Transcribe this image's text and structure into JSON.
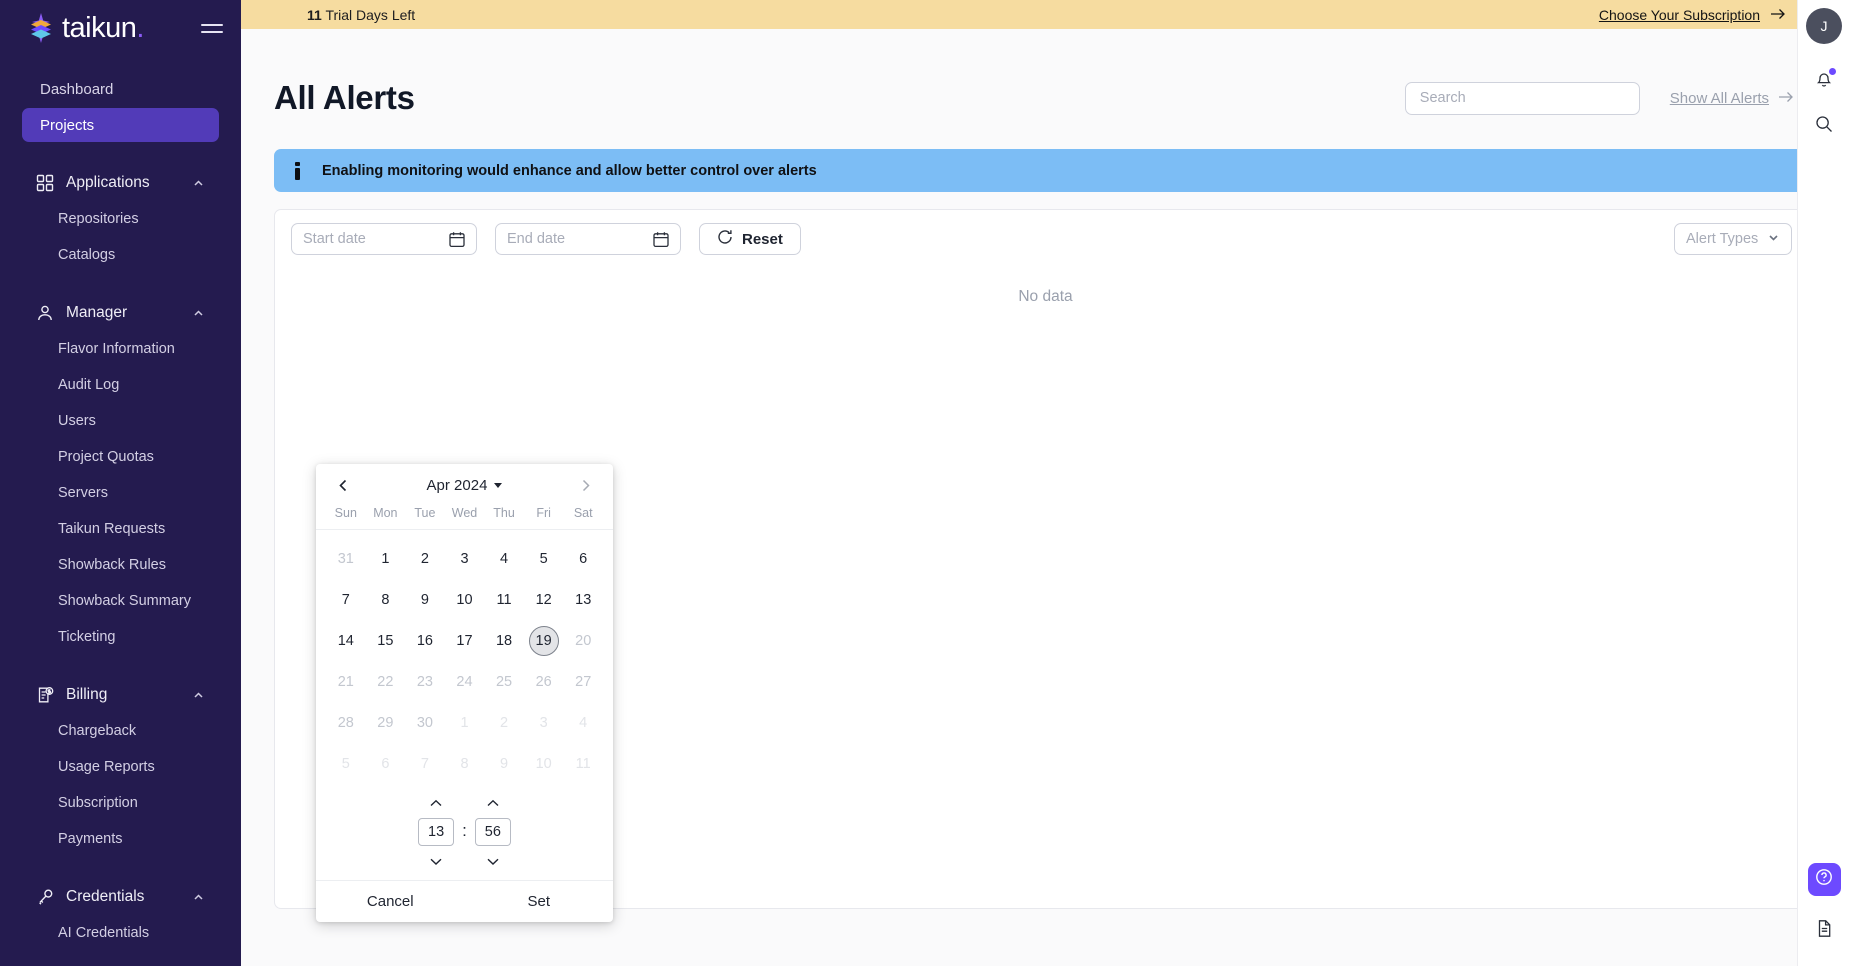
{
  "brand": {
    "name": "taikun",
    "dot": ".",
    "logo_icon": "taikun-logo-icon",
    "menu_icon": "hamburger-menu-icon"
  },
  "sidebar": {
    "top_items": [
      {
        "label": "Dashboard",
        "active": false
      },
      {
        "label": "Projects",
        "active": true
      }
    ],
    "groups": [
      {
        "label": "Applications",
        "icon": "grid-icon",
        "chevron": "chevron-up-icon",
        "items": [
          {
            "label": "Repositories"
          },
          {
            "label": "Catalogs"
          }
        ]
      },
      {
        "label": "Manager",
        "icon": "user-icon",
        "chevron": "chevron-up-icon",
        "items": [
          {
            "label": "Flavor Information"
          },
          {
            "label": "Audit Log"
          },
          {
            "label": "Users"
          },
          {
            "label": "Project Quotas"
          },
          {
            "label": "Servers"
          },
          {
            "label": "Taikun Requests"
          },
          {
            "label": "Showback Rules"
          },
          {
            "label": "Showback Summary"
          },
          {
            "label": "Ticketing"
          }
        ]
      },
      {
        "label": "Billing",
        "icon": "invoice-dollar-icon",
        "chevron": "chevron-up-icon",
        "items": [
          {
            "label": "Chargeback"
          },
          {
            "label": "Usage Reports"
          },
          {
            "label": "Subscription"
          },
          {
            "label": "Payments"
          }
        ]
      },
      {
        "label": "Credentials",
        "icon": "key-icon",
        "chevron": "chevron-up-icon",
        "items": [
          {
            "label": "AI Credentials"
          }
        ]
      }
    ]
  },
  "trial_bar": {
    "days": "11",
    "text": " Trial Days Left",
    "cta_label": "Choose Your Subscription",
    "cta_icon": "arrow-right-icon",
    "bg_color": "#f6dca0"
  },
  "header": {
    "title": "All Alerts",
    "search": {
      "value": "",
      "placeholder": "Search",
      "name": "search-input"
    },
    "show_all_label": "Show All Alerts",
    "show_all_icon": "arrow-right-icon"
  },
  "info_banner": {
    "icon": "info-icon",
    "message": "Enabling monitoring would enhance and allow better control over alerts",
    "bg_color": "#7cbdf5"
  },
  "filters": {
    "start_date": {
      "value": "",
      "placeholder": "Start date",
      "icon": "calendar-icon"
    },
    "end_date": {
      "value": "",
      "placeholder": "End date",
      "icon": "calendar-icon"
    },
    "reset_label": "Reset",
    "reset_icon": "refresh-icon",
    "alert_types": {
      "value": "Alert Types",
      "icon": "chevron-down-icon"
    }
  },
  "table": {
    "empty_message": "No data"
  },
  "calendar": {
    "prev_icon": "chevron-left-icon",
    "next_icon": "chevron-right-icon",
    "month_label": "Apr 2024",
    "caret_icon": "caret-down-icon",
    "day_names": [
      "Sun",
      "Mon",
      "Tue",
      "Wed",
      "Thu",
      "Fri",
      "Sat"
    ],
    "weeks": [
      [
        {
          "d": "31",
          "s": "muted"
        },
        {
          "d": "1",
          "s": ""
        },
        {
          "d": "2",
          "s": ""
        },
        {
          "d": "3",
          "s": ""
        },
        {
          "d": "4",
          "s": ""
        },
        {
          "d": "5",
          "s": ""
        },
        {
          "d": "6",
          "s": ""
        }
      ],
      [
        {
          "d": "7",
          "s": ""
        },
        {
          "d": "8",
          "s": ""
        },
        {
          "d": "9",
          "s": ""
        },
        {
          "d": "10",
          "s": ""
        },
        {
          "d": "11",
          "s": ""
        },
        {
          "d": "12",
          "s": ""
        },
        {
          "d": "13",
          "s": ""
        }
      ],
      [
        {
          "d": "14",
          "s": ""
        },
        {
          "d": "15",
          "s": ""
        },
        {
          "d": "16",
          "s": ""
        },
        {
          "d": "17",
          "s": ""
        },
        {
          "d": "18",
          "s": ""
        },
        {
          "d": "19",
          "s": "today"
        },
        {
          "d": "20",
          "s": "muted"
        }
      ],
      [
        {
          "d": "21",
          "s": "muted"
        },
        {
          "d": "22",
          "s": "muted"
        },
        {
          "d": "23",
          "s": "muted"
        },
        {
          "d": "24",
          "s": "muted"
        },
        {
          "d": "25",
          "s": "muted"
        },
        {
          "d": "26",
          "s": "muted"
        },
        {
          "d": "27",
          "s": "muted"
        }
      ],
      [
        {
          "d": "28",
          "s": "muted"
        },
        {
          "d": "29",
          "s": "muted"
        },
        {
          "d": "30",
          "s": "muted"
        },
        {
          "d": "1",
          "s": "faint"
        },
        {
          "d": "2",
          "s": "faint"
        },
        {
          "d": "3",
          "s": "faint"
        },
        {
          "d": "4",
          "s": "faint"
        }
      ],
      [
        {
          "d": "5",
          "s": "faint"
        },
        {
          "d": "6",
          "s": "faint"
        },
        {
          "d": "7",
          "s": "faint"
        },
        {
          "d": "8",
          "s": "faint"
        },
        {
          "d": "9",
          "s": "faint"
        },
        {
          "d": "10",
          "s": "faint"
        },
        {
          "d": "11",
          "s": "faint"
        }
      ]
    ],
    "time": {
      "hours": "13",
      "minutes": "56",
      "separator": ":",
      "up_icon": "chevron-up-icon",
      "down_icon": "chevron-down-icon"
    },
    "cancel_label": "Cancel",
    "set_label": "Set"
  },
  "rail": {
    "avatar_initial": "J",
    "icons": [
      {
        "name": "bell-icon",
        "badge": true
      },
      {
        "name": "search-icon",
        "badge": false
      }
    ],
    "help_icon": "help-circle-icon",
    "docs_icon": "document-icon",
    "accent_color": "#6d4aff"
  }
}
